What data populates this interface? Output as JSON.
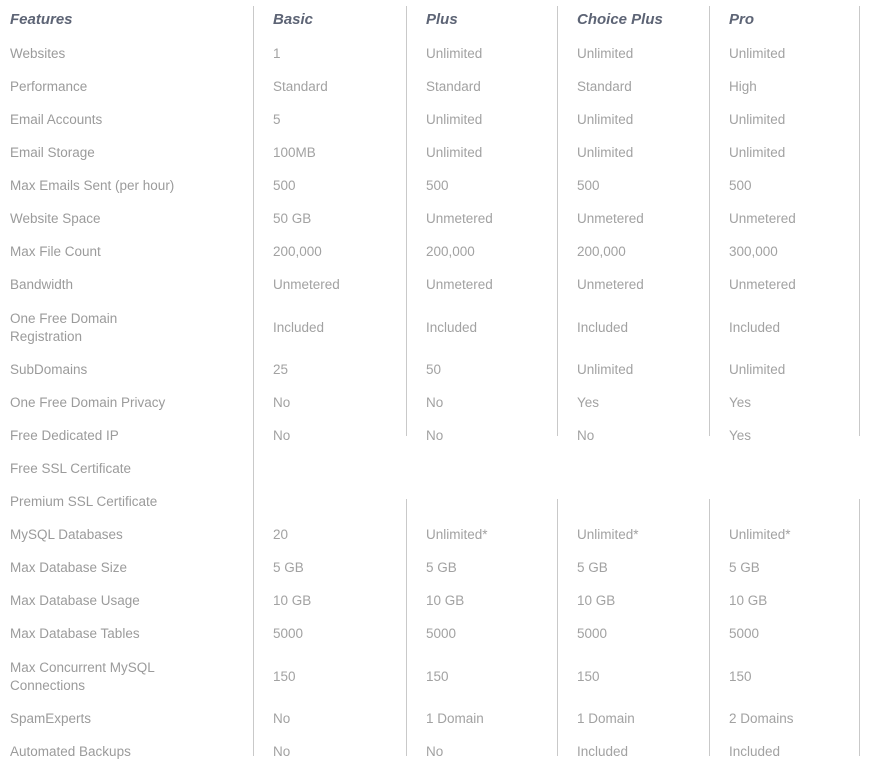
{
  "table": {
    "columns": [
      {
        "key": "feature",
        "label": "Features"
      },
      {
        "key": "basic",
        "label": "Basic"
      },
      {
        "key": "plus",
        "label": "Plus"
      },
      {
        "key": "choice_plus",
        "label": "Choice Plus"
      },
      {
        "key": "pro",
        "label": "Pro"
      }
    ],
    "rows": [
      {
        "feature": "Websites",
        "basic": "1",
        "plus": "Unlimited",
        "choice_plus": "Unlimited",
        "pro": "Unlimited"
      },
      {
        "feature": "Performance",
        "basic": "Standard",
        "plus": "Standard",
        "choice_plus": "Standard",
        "pro": "High"
      },
      {
        "feature": "Email Accounts",
        "basic": "5",
        "plus": "Unlimited",
        "choice_plus": "Unlimited",
        "pro": "Unlimited"
      },
      {
        "feature": "Email Storage",
        "basic": "100MB",
        "plus": "Unlimited",
        "choice_plus": "Unlimited",
        "pro": "Unlimited"
      },
      {
        "feature": "Max Emails Sent (per hour)",
        "basic": "500",
        "plus": "500",
        "choice_plus": "500",
        "pro": "500"
      },
      {
        "feature": "Website Space",
        "basic": "50 GB",
        "plus": "Unmetered",
        "choice_plus": "Unmetered",
        "pro": "Unmetered"
      },
      {
        "feature": "Max File Count",
        "basic": "200,000",
        "plus": "200,000",
        "choice_plus": "200,000",
        "pro": "300,000"
      },
      {
        "feature": "Bandwidth",
        "basic": "Unmetered",
        "plus": "Unmetered",
        "choice_plus": "Unmetered",
        "pro": "Unmetered"
      },
      {
        "feature": "One Free Domain Registration",
        "basic": "Included",
        "plus": "Included",
        "choice_plus": "Included",
        "pro": "Included"
      },
      {
        "feature": "SubDomains",
        "basic": "25",
        "plus": "50",
        "choice_plus": "Unlimited",
        "pro": "Unlimited"
      },
      {
        "feature": "One Free Domain Privacy",
        "basic": "No",
        "plus": "No",
        "choice_plus": "Yes",
        "pro": "Yes"
      },
      {
        "feature": "Free Dedicated IP",
        "basic": "No",
        "plus": "No",
        "choice_plus": "No",
        "pro": "Yes"
      },
      {
        "feature": "Free SSL Certificate",
        "basic": "",
        "plus": "",
        "choice_plus": "",
        "pro": ""
      },
      {
        "feature": "Premium SSL Certificate",
        "basic": "",
        "plus": "",
        "choice_plus": "",
        "pro": ""
      },
      {
        "feature": "MySQL Databases",
        "basic": "20",
        "plus": "Unlimited*",
        "choice_plus": "Unlimited*",
        "pro": "Unlimited*"
      },
      {
        "feature": "Max Database Size",
        "basic": "5 GB",
        "plus": "5 GB",
        "choice_plus": "5 GB",
        "pro": "5 GB"
      },
      {
        "feature": "Max Database Usage",
        "basic": "10 GB",
        "plus": "10 GB",
        "choice_plus": "10 GB",
        "pro": "10 GB"
      },
      {
        "feature": "Max Database Tables",
        "basic": "5000",
        "plus": "5000",
        "choice_plus": "5000",
        "pro": "5000"
      },
      {
        "feature": "Max Concurrent MySQL Connections",
        "basic": "150",
        "plus": "150",
        "choice_plus": "150",
        "pro": "150"
      },
      {
        "feature": "SpamExperts",
        "basic": "No",
        "plus": "1 Domain",
        "choice_plus": "1 Domain",
        "pro": "2 Domains"
      },
      {
        "feature": "Automated Backups",
        "basic": "No",
        "plus": "No",
        "choice_plus": "Included",
        "pro": "Included"
      }
    ]
  },
  "style": {
    "header_text_color": "#5d6475",
    "body_text_color": "#a2a2a2",
    "divider_color": "#c9c9c9",
    "background_color": "#ffffff"
  }
}
